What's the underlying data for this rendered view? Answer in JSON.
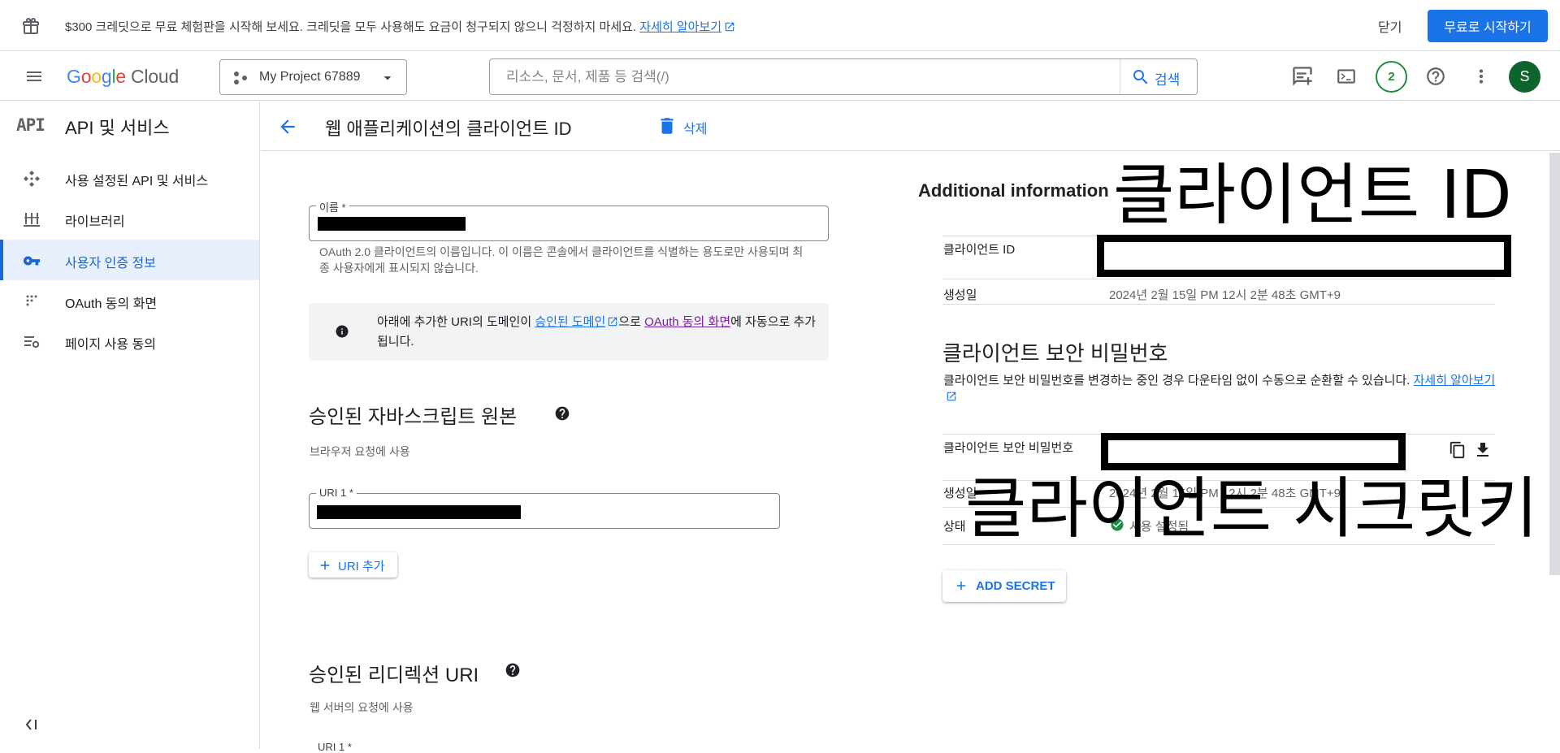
{
  "promo": {
    "message": "$300 크레딧으로 무료 체험판을 시작해 보세요. 크레딧을 모두 사용해도 요금이 청구되지 않으니 걱정하지 마세요.",
    "learn_more": "자세히 알아보기",
    "close_label": "닫기",
    "start_label": "무료로 시작하기"
  },
  "header": {
    "logo_letters": [
      "G",
      "o",
      "o",
      "g",
      "l",
      "e"
    ],
    "logo_suffix": "Cloud",
    "project": "My Project 67889",
    "search_placeholder": "리소스, 문서, 제품 등 검색(/)",
    "search_button": "검색",
    "notification_count": "2",
    "avatar_letter": "S"
  },
  "sidebar": {
    "api_mark": "API",
    "title": "API 및 서비스",
    "items": [
      {
        "label": "사용 설정된 API 및 서비스",
        "icon": "diamond-dots-icon",
        "active": false
      },
      {
        "label": "라이브러리",
        "icon": "library-icon",
        "active": false
      },
      {
        "label": "사용자 인증 정보",
        "icon": "key-icon",
        "active": true
      },
      {
        "label": "OAuth 동의 화면",
        "icon": "dots-grid-icon",
        "active": false
      },
      {
        "label": "페이지 사용 동의",
        "icon": "settings-list-icon",
        "active": false
      }
    ]
  },
  "page": {
    "title": "웹 애플리케이션의 클라이언트 ID",
    "delete_label": "삭제"
  },
  "form": {
    "name_label": "이름 *",
    "name_hint": "OAuth 2.0 클라이언트의 이름입니다. 이 이름은 콘솔에서 클라이언트를 식별하는 용도로만 사용되며 최종 사용자에게 표시되지 않습니다.",
    "info": {
      "before": "아래에 추가한 URI의 도메인이 ",
      "link1": "승인된 도메인",
      "middle": "으로 ",
      "link2": "OAuth 동의 화면",
      "after": "에 자동으로 추가됩니다."
    },
    "js_origins_title": "승인된 자바스크립트 원본",
    "js_origins_sub": "브라우저 요청에 사용",
    "uri1_label": "URI 1 *",
    "add_uri_label": "URI 추가",
    "redirect_title": "승인된 리디렉션 URI",
    "redirect_sub": "웹 서버의 요청에 사용",
    "redirect_uri1_label": "URI 1 *"
  },
  "right": {
    "heading": "Additional information",
    "annotation_client_id": "클라이언트 ID",
    "client_id_key": "클라이언트 ID",
    "created_key": "생성일",
    "created_value": "2024년 2월 15일 PM 12시 2분 48초 GMT+9",
    "secret_title": "클라이언트 보안 비밀번호",
    "secret_desc": "클라이언트 보안 비밀번호를 변경하는 중인 경우 다운타임 없이 수동으로 순환할 수 있습니다. ",
    "secret_learn_more": "자세히 알아보기",
    "secret_key": "클라이언트 보안 비밀번호",
    "secret_created_key": "생성일",
    "secret_created_value": "2024년 2월 15일 PM 12시 2분 48초 GMT+9",
    "status_key": "상태",
    "status_value": "사용 설정됨",
    "annotation_secret": "클라이언트 시크릿키",
    "add_secret_label": "ADD SECRET"
  },
  "colors": {
    "primary": "#1a73e8",
    "active_nav": "#1967d2",
    "active_nav_bg": "#e8f0fe",
    "status_green": "#1e8e3e",
    "avatar_bg": "#0d652d"
  }
}
